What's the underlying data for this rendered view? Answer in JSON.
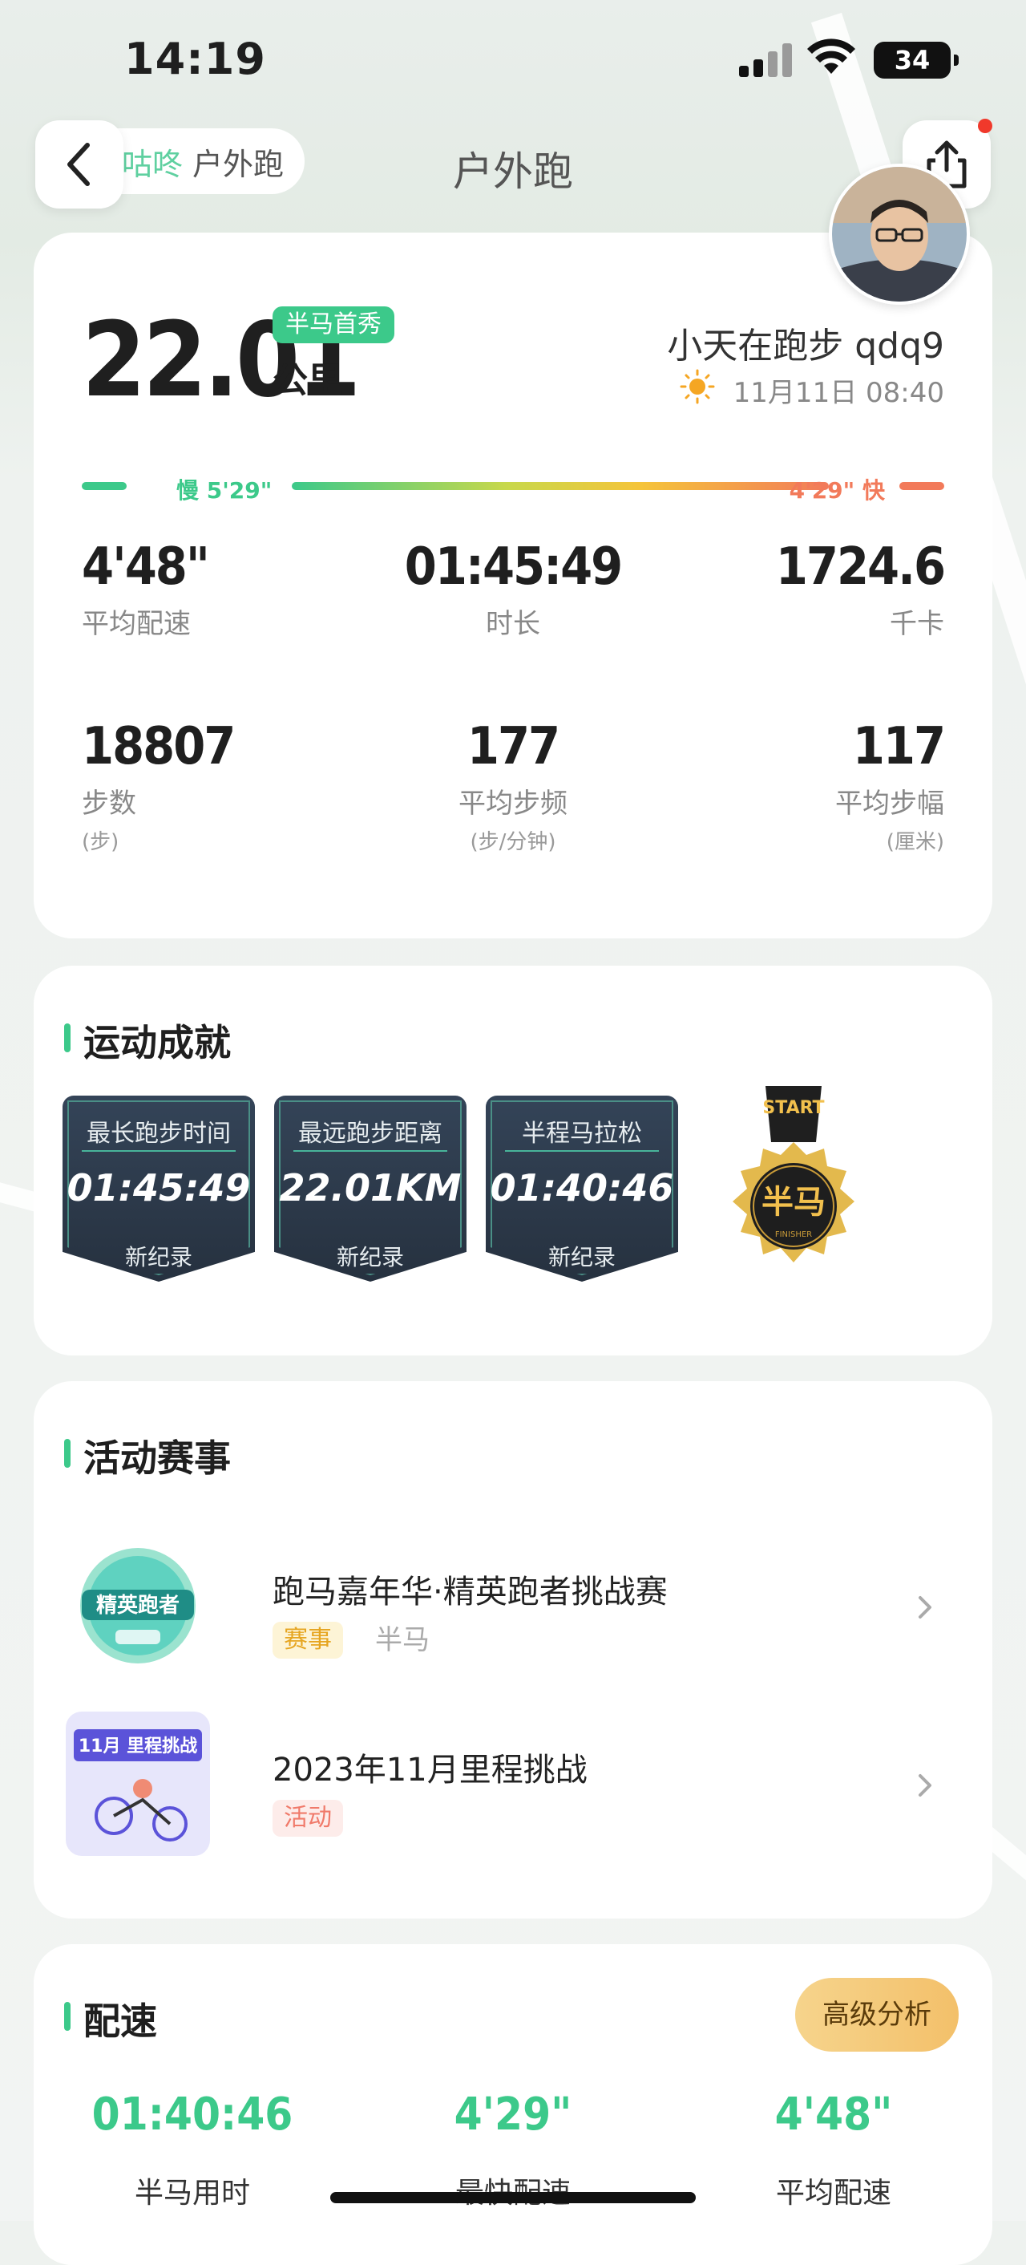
{
  "status_bar": {
    "time": "14:19",
    "battery": "34"
  },
  "nav": {
    "brand": "咕咚",
    "app_sub": "户外跑",
    "title": "户外跑"
  },
  "summary": {
    "distance": "22.01",
    "badge": "半马首秀",
    "unit": "公里",
    "user": "小天在跑步 qdq9",
    "date": "11月11日 08:40",
    "pace_slow": "慢 5'29\"",
    "pace_fast": "4'29\" 快",
    "stats": [
      {
        "value": "4'48\"",
        "label": "平均配速",
        "unit": ""
      },
      {
        "value": "01:45:49",
        "label": "时长",
        "unit": ""
      },
      {
        "value": "1724.6",
        "label": "千卡",
        "unit": ""
      },
      {
        "value": "18807",
        "label": "步数",
        "unit": "(步)"
      },
      {
        "value": "177",
        "label": "平均步频",
        "unit": "(步/分钟)"
      },
      {
        "value": "117",
        "label": "平均步幅",
        "unit": "(厘米)"
      }
    ]
  },
  "achievements": {
    "title": "运动成就",
    "items": [
      {
        "title": "最长跑步时间",
        "value": "01:45:49",
        "note": "新纪录"
      },
      {
        "title": "最远跑步距离",
        "value": "22.01KM",
        "note": "新纪录"
      },
      {
        "title": "半程马拉松",
        "value": "01:40:46",
        "note": "新纪录"
      }
    ],
    "medal": {
      "top": "START",
      "main": "半马",
      "small": "FINISHER"
    }
  },
  "events": {
    "title": "活动赛事",
    "items": [
      {
        "title": "跑马嘉年华·精英跑者挑战赛",
        "tag": "赛事",
        "sub": "半马",
        "thumb_text": "精英跑者"
      },
      {
        "title": "2023年11月里程挑战",
        "tag": "活动",
        "sub": "",
        "thumb_text": "11月 里程挑战"
      }
    ]
  },
  "pace": {
    "title": "配速",
    "adv_button": "高级分析",
    "stats": [
      {
        "value": "01:40:46",
        "label": "半马用时"
      },
      {
        "value": "4'29\"",
        "label": "最快配速"
      },
      {
        "value": "4'48\"",
        "label": "平均配速"
      }
    ]
  },
  "colors": {
    "accent": "#3cc98a",
    "fast": "#f27a5a",
    "card": "#ffffff"
  }
}
